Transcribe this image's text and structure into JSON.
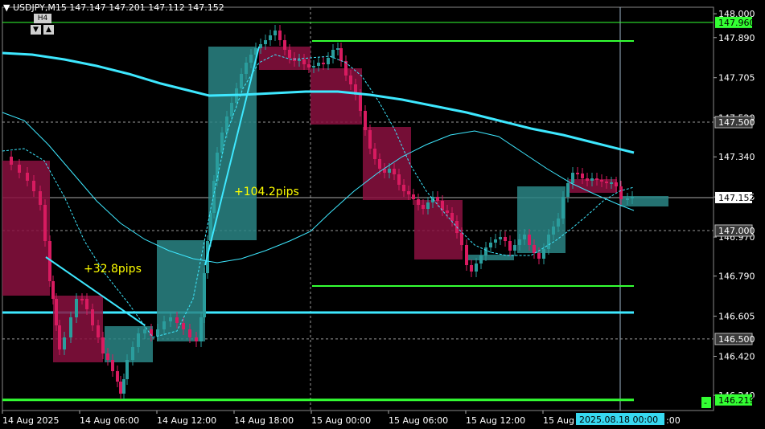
{
  "header": {
    "collapse_icon": "triangle-down-icon",
    "symbol_line": "USDJPY,M15  147.147 147.201 147.112 147.152"
  },
  "timeframe": {
    "label": "H4",
    "down_icon": "arrow-down-icon",
    "up_icon": "arrow-up-icon"
  },
  "price_axis": {
    "ticks": [
      "148.000",
      "147.890",
      "147.705",
      "147.520",
      "147.340",
      "147.155",
      "146.970",
      "146.790",
      "146.605",
      "146.420",
      "146.240"
    ],
    "tags": [
      {
        "label": "147.960",
        "style": "green"
      },
      {
        "label": "147.500",
        "style": "gray"
      },
      {
        "label": "147.152",
        "style": "white"
      },
      {
        "label": "147.000",
        "style": "gray"
      },
      {
        "label": "146.500",
        "style": "gray"
      },
      {
        "label": "146.219",
        "style": "green"
      }
    ],
    "minus_label": "-"
  },
  "time_axis": {
    "labels": [
      "14 Aug 2025",
      "14 Aug 06:00",
      "14 Aug 12:00",
      "14 Aug 18:00",
      "15 Aug 00:00",
      "15 Aug 06:00",
      "15 Aug 12:00",
      "15 Aug"
    ],
    "cursor_label": "2025.08.18 00:00",
    "trailing_label": ":00"
  },
  "annotations": [
    {
      "text": "+104.2pips",
      "color": "#ffff00"
    },
    {
      "text": "+32.8pips",
      "color": "#ffff00"
    }
  ],
  "colors": {
    "bull": "#2a9d9d",
    "bear": "#d81b60",
    "ma": "#3ee8ff",
    "level": "#33ff33"
  },
  "chart_data": {
    "type": "candlestick",
    "symbol": "USDJPY",
    "timeframe": "M15",
    "ylim": [
      146.17,
      148.03
    ],
    "x_labels": [
      "14 Aug 2025",
      "14 Aug 06:00",
      "14 Aug 12:00",
      "14 Aug 18:00",
      "15 Aug 00:00",
      "15 Aug 06:00",
      "15 Aug 12:00",
      "15 Aug"
    ],
    "last_price": 147.152,
    "horizontal_levels": [
      147.96,
      147.5,
      147.0,
      146.5,
      146.219
    ],
    "pips_annotations": [
      {
        "text": "+104.2pips"
      },
      {
        "text": "+32.8pips"
      }
    ]
  }
}
